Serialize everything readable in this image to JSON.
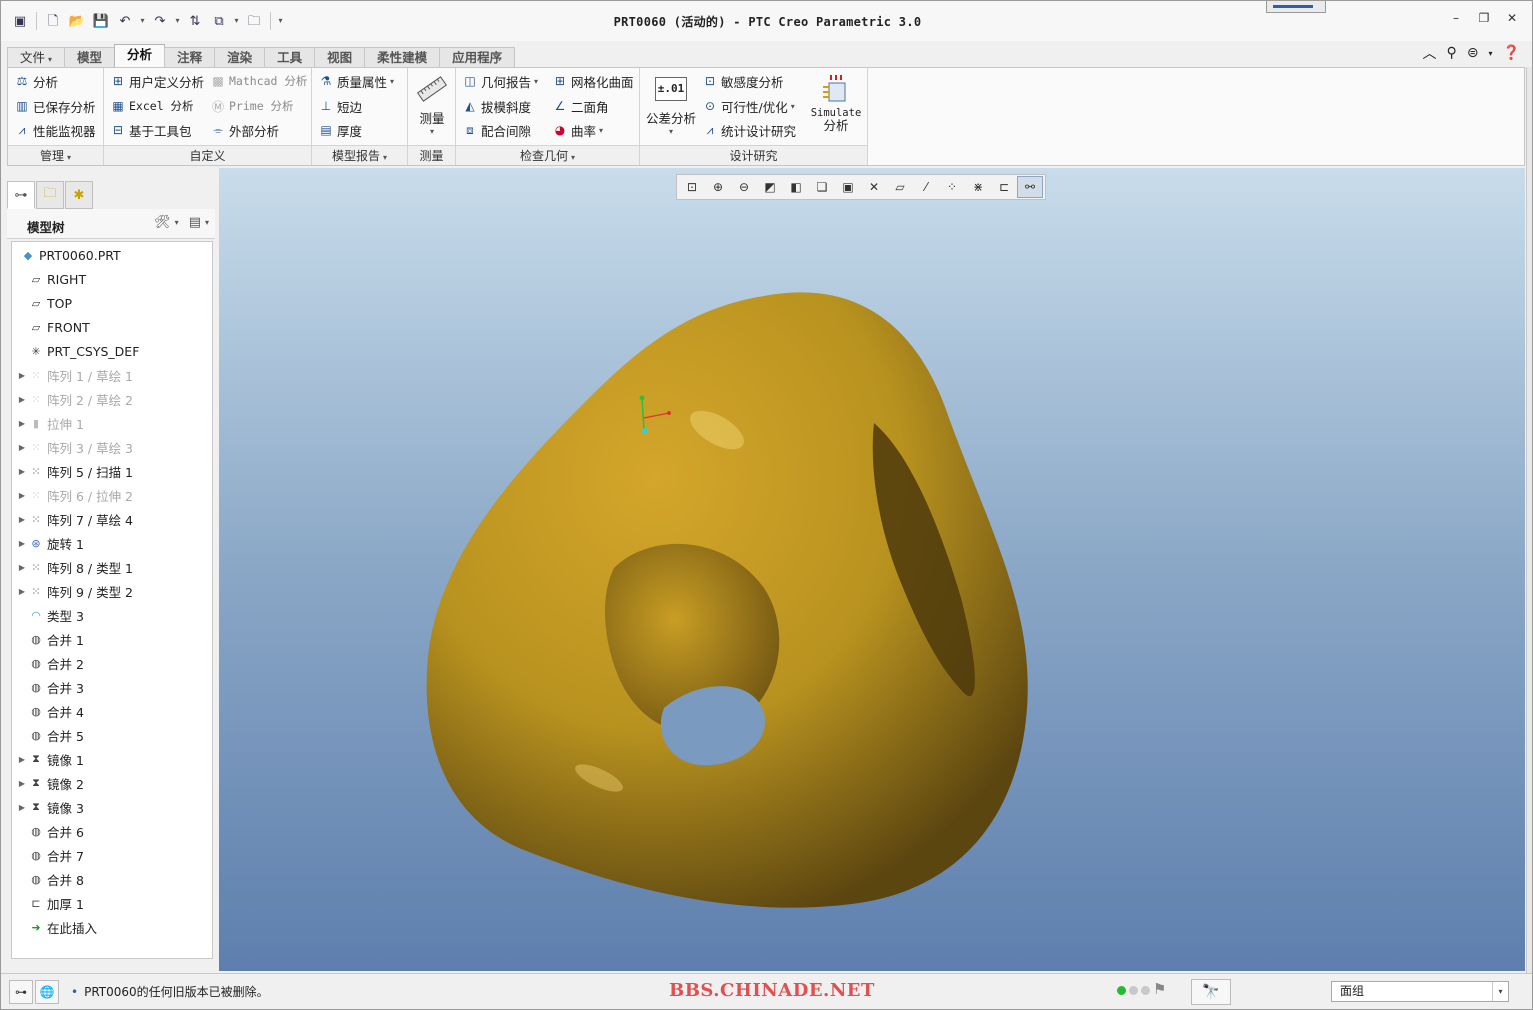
{
  "window": {
    "title": "PRT0060 (活动的) - PTC Creo Parametric 3.0",
    "minimize": "–",
    "restore": "❐",
    "close": "✕"
  },
  "tabs": [
    "文件",
    "模型",
    "分析",
    "注释",
    "渲染",
    "工具",
    "视图",
    "柔性建模",
    "应用程序"
  ],
  "ribbon": {
    "manage": {
      "label": "管理",
      "items": [
        "分析",
        "已保存分析",
        "性能监视器"
      ]
    },
    "custom": {
      "label": "自定义",
      "user_defined": "用户定义分析",
      "excel": "Excel 分析",
      "toolkit": "基于工具包",
      "mathcad": "Mathcad 分析",
      "prime": "Prime 分析",
      "external": "外部分析"
    },
    "model_report": {
      "label": "模型报告",
      "items": [
        "质量属性",
        "短边",
        "厚度"
      ]
    },
    "measure": {
      "label": "测量",
      "button": "测量"
    },
    "inspect": {
      "label": "检查几何",
      "items": [
        "几何报告",
        "拔模斜度",
        "配合间隙",
        "网格化曲面",
        "二面角",
        "曲率"
      ]
    },
    "design_study": {
      "label": "设计研究",
      "tolerance": "公差分析",
      "tolerance_icon": "±.01",
      "items": [
        "敏感度分析",
        "可行性/优化",
        "统计设计研究"
      ],
      "simulate_line1": "Simulate",
      "simulate_line2": "分析"
    }
  },
  "model_tree": {
    "title": "模型树",
    "nodes": [
      {
        "label": "PRT0060.PRT",
        "icon": "part-icon",
        "expand": false,
        "disabled": false
      },
      {
        "label": "RIGHT",
        "icon": "datum-plane-icon",
        "expand": false,
        "disabled": false
      },
      {
        "label": "TOP",
        "icon": "datum-plane-icon",
        "expand": false,
        "disabled": false
      },
      {
        "label": "FRONT",
        "icon": "datum-plane-icon",
        "expand": false,
        "disabled": false
      },
      {
        "label": "PRT_CSYS_DEF",
        "icon": "csys-icon",
        "expand": false,
        "disabled": false
      },
      {
        "label": "阵列 1 / 草绘 1",
        "icon": "pattern-icon",
        "expand": true,
        "disabled": true
      },
      {
        "label": "阵列 2 / 草绘 2",
        "icon": "pattern-icon",
        "expand": true,
        "disabled": true
      },
      {
        "label": "拉伸 1",
        "icon": "extrude-icon",
        "expand": true,
        "disabled": true
      },
      {
        "label": "阵列 3 / 草绘 3",
        "icon": "pattern-icon",
        "expand": true,
        "disabled": true
      },
      {
        "label": "阵列 5 / 扫描 1",
        "icon": "pattern-icon",
        "expand": true,
        "disabled": false
      },
      {
        "label": "阵列 6 / 拉伸 2",
        "icon": "pattern-icon",
        "expand": true,
        "disabled": true
      },
      {
        "label": "阵列 7 / 草绘 4",
        "icon": "pattern-icon",
        "expand": true,
        "disabled": false
      },
      {
        "label": "旋转 1",
        "icon": "revolve-icon",
        "expand": true,
        "disabled": false
      },
      {
        "label": "阵列 8 / 类型 1",
        "icon": "pattern-icon",
        "expand": true,
        "disabled": false
      },
      {
        "label": "阵列 9 / 类型 2",
        "icon": "pattern-icon",
        "expand": true,
        "disabled": false
      },
      {
        "label": "类型 3",
        "icon": "surface-icon",
        "expand": false,
        "disabled": false
      },
      {
        "label": "合并 1",
        "icon": "merge-icon",
        "expand": false,
        "disabled": false
      },
      {
        "label": "合并 2",
        "icon": "merge-icon",
        "expand": false,
        "disabled": false
      },
      {
        "label": "合并 3",
        "icon": "merge-icon",
        "expand": false,
        "disabled": false
      },
      {
        "label": "合并 4",
        "icon": "merge-icon",
        "expand": false,
        "disabled": false
      },
      {
        "label": "合并 5",
        "icon": "merge-icon",
        "expand": false,
        "disabled": false
      },
      {
        "label": "镜像 1",
        "icon": "mirror-icon",
        "expand": true,
        "disabled": false
      },
      {
        "label": "镜像 2",
        "icon": "mirror-icon",
        "expand": true,
        "disabled": false
      },
      {
        "label": "镜像 3",
        "icon": "mirror-icon",
        "expand": true,
        "disabled": false
      },
      {
        "label": "合并 6",
        "icon": "merge-icon",
        "expand": false,
        "disabled": false
      },
      {
        "label": "合并 7",
        "icon": "merge-icon",
        "expand": false,
        "disabled": false
      },
      {
        "label": "合并 8",
        "icon": "merge-icon",
        "expand": false,
        "disabled": false
      },
      {
        "label": "加厚 1",
        "icon": "thicken-icon",
        "expand": false,
        "disabled": false
      },
      {
        "label": "在此插入",
        "icon": "insert-here-icon",
        "expand": false,
        "disabled": false
      }
    ]
  },
  "status": {
    "message": "PRT0060的任何旧版本已被删除。",
    "watermark": "BBS.CHINADE.NET",
    "filter_value": "面组"
  },
  "colors": {
    "model": "#b8921f",
    "accent": "#2d5fa8",
    "watermark": "#e05050"
  }
}
